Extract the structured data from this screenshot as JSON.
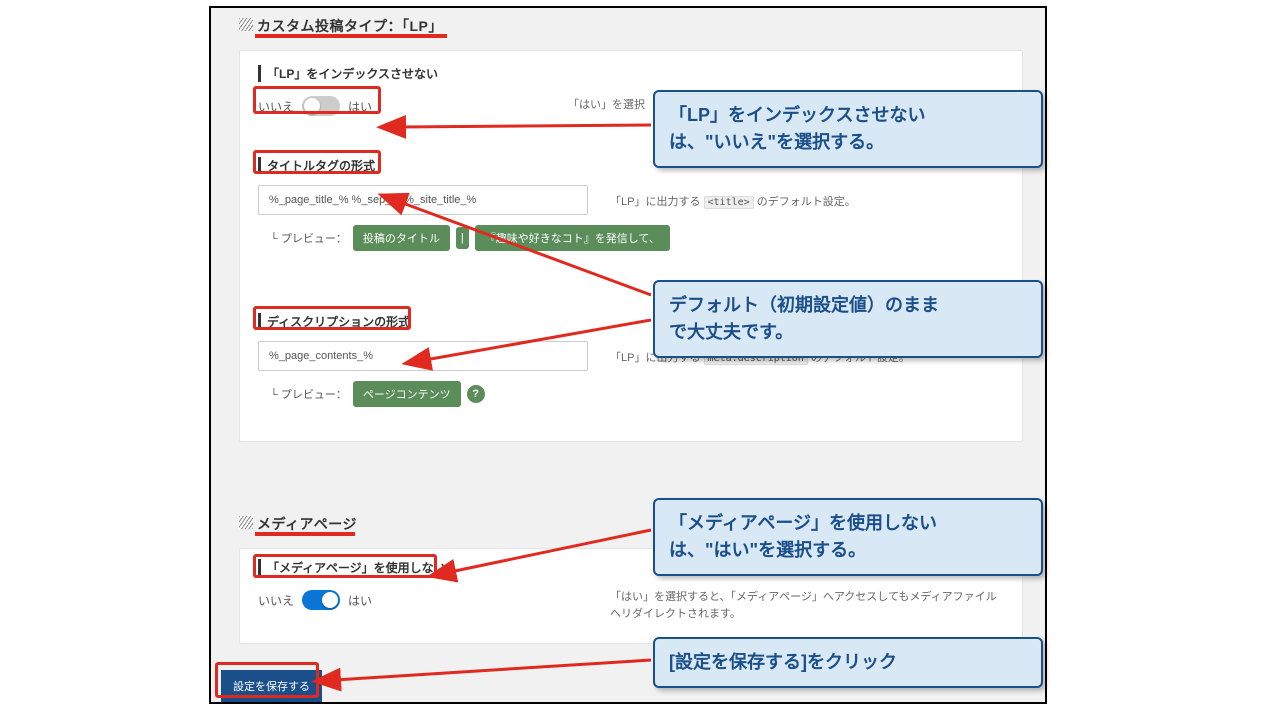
{
  "section1": {
    "title": "カスタム投稿タイプ：「LP」",
    "noindex_label": "「LP」をインデックスさせない",
    "no_text": "いいえ",
    "yes_text": "はい",
    "noindex_hint_partial": "「はい」を選択",
    "title_format_label": "タイトルタグの形式",
    "title_format_value": "%_page_title_% %_sep_% %_site_title_%",
    "title_help_pre": "「LP」に出力する ",
    "title_help_code": "<title>",
    "title_help_post": " のデフォルト設定。",
    "preview_label": "└ プレビュー：",
    "preview_tag1": "投稿のタイトル",
    "preview_sep": "|",
    "preview_tag2": "『趣味や好きなコト』を発信して、",
    "desc_label": "ディスクリプションの形式",
    "desc_value": "%_page_contents_%",
    "desc_help_pre": "「LP」に出力する ",
    "desc_help_code": "meta:description",
    "desc_help_post": " のデフォルト設定。",
    "desc_preview_tag": "ページコンテンツ",
    "help_icon": "?"
  },
  "section2": {
    "title": "メディアページ",
    "label": "「メディアページ」を使用しない",
    "no_text": "いいえ",
    "yes_text": "はい",
    "help": "「はい」を選択すると、「メディアページ」へアクセスしてもメディアファイルへリダイレクトされます。"
  },
  "save_button": "設定を保存する",
  "callouts": {
    "c1_l1": "「LP」をインデックスさせない",
    "c1_l2": "は、\"いいえ\"を選択する。",
    "c2_l1": "デフォルト（初期設定値）のまま",
    "c2_l2": "で大丈夫です。",
    "c3_l1": "「メディアページ」を使用しない",
    "c3_l2": "は、\"はい\"を選択する。",
    "c4": "[設定を保存する]をクリック"
  }
}
